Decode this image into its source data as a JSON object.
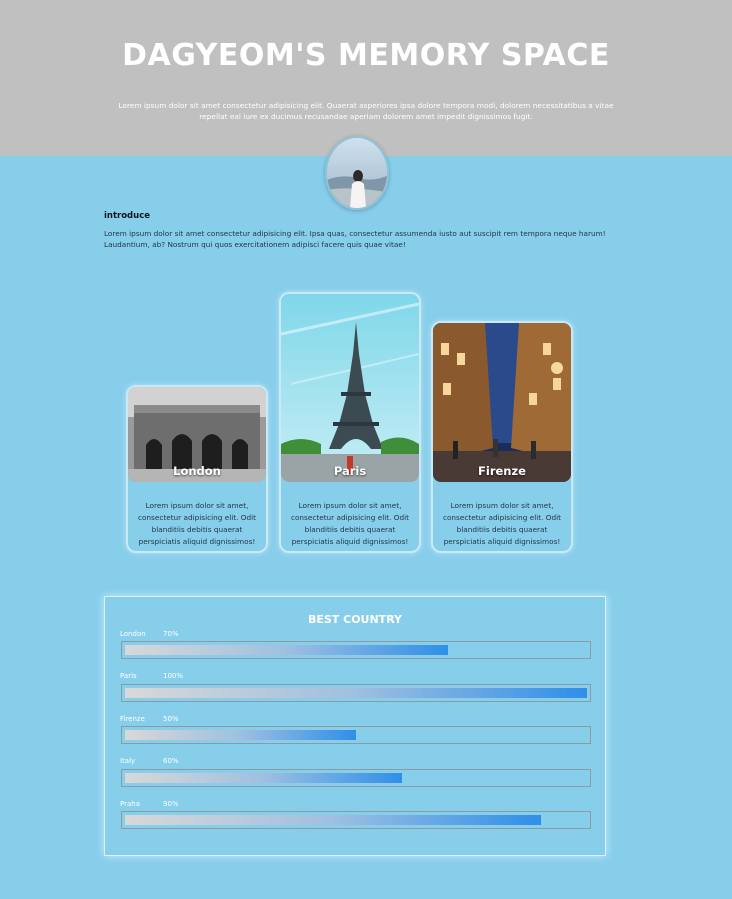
{
  "header": {
    "title": "DAGYEOM'S MEMORY SPACE",
    "subtitle": "Lorem ipsum dolor sit amet consectetur adipisicing elit. Quaerat asperiores ipsa dolore tempora modi, dolorem necessitatibus a vitae repellat eal iure ex ducimus recusandae aperiam dolorem amet impedit dignissimos fugit."
  },
  "intro": {
    "title": "introduce",
    "text": "Lorem ipsum dolor sit amet consectetur adipisicing elit. Ipsa quas, consectetur assumenda iusto aut suscipit rem tempora neque harum! Laudantium, ab? Nostrum qui quos exercitationem adipisci facere quis quae vitae!"
  },
  "cards": [
    {
      "city": "London",
      "desc": "Lorem ipsum dolor sit amet, consectetur adipisicing elit. Odit blanditiis debitis quaerat perspiciatis aliquid dignissimos!"
    },
    {
      "city": "Paris",
      "desc": "Lorem ipsum dolor sit amet, consectetur adipisicing elit. Odit blanditiis debitis quaerat perspiciatis aliquid dignissimos!"
    },
    {
      "city": "Firenze",
      "desc": "Lorem ipsum dolor sit amet, consectetur adipisicing elit. Odit blanditiis debitis quaerat perspiciatis aliquid dignissimos!"
    }
  ],
  "best_country": {
    "title": "BEST COUNTRY",
    "rows": [
      {
        "name": "London",
        "pct_label": "70%",
        "value": 70
      },
      {
        "name": "Paris",
        "pct_label": "100%",
        "value": 100
      },
      {
        "name": "Firenze",
        "pct_label": "50%",
        "value": 50
      },
      {
        "name": "Italy",
        "pct_label": "60%",
        "value": 60
      },
      {
        "name": "Praha",
        "pct_label": "90%",
        "value": 90
      }
    ]
  },
  "colors": {
    "page_bg": "#87ceeb",
    "header_bg": "#c0c0c0",
    "bar_end": "#2f8fe8"
  }
}
